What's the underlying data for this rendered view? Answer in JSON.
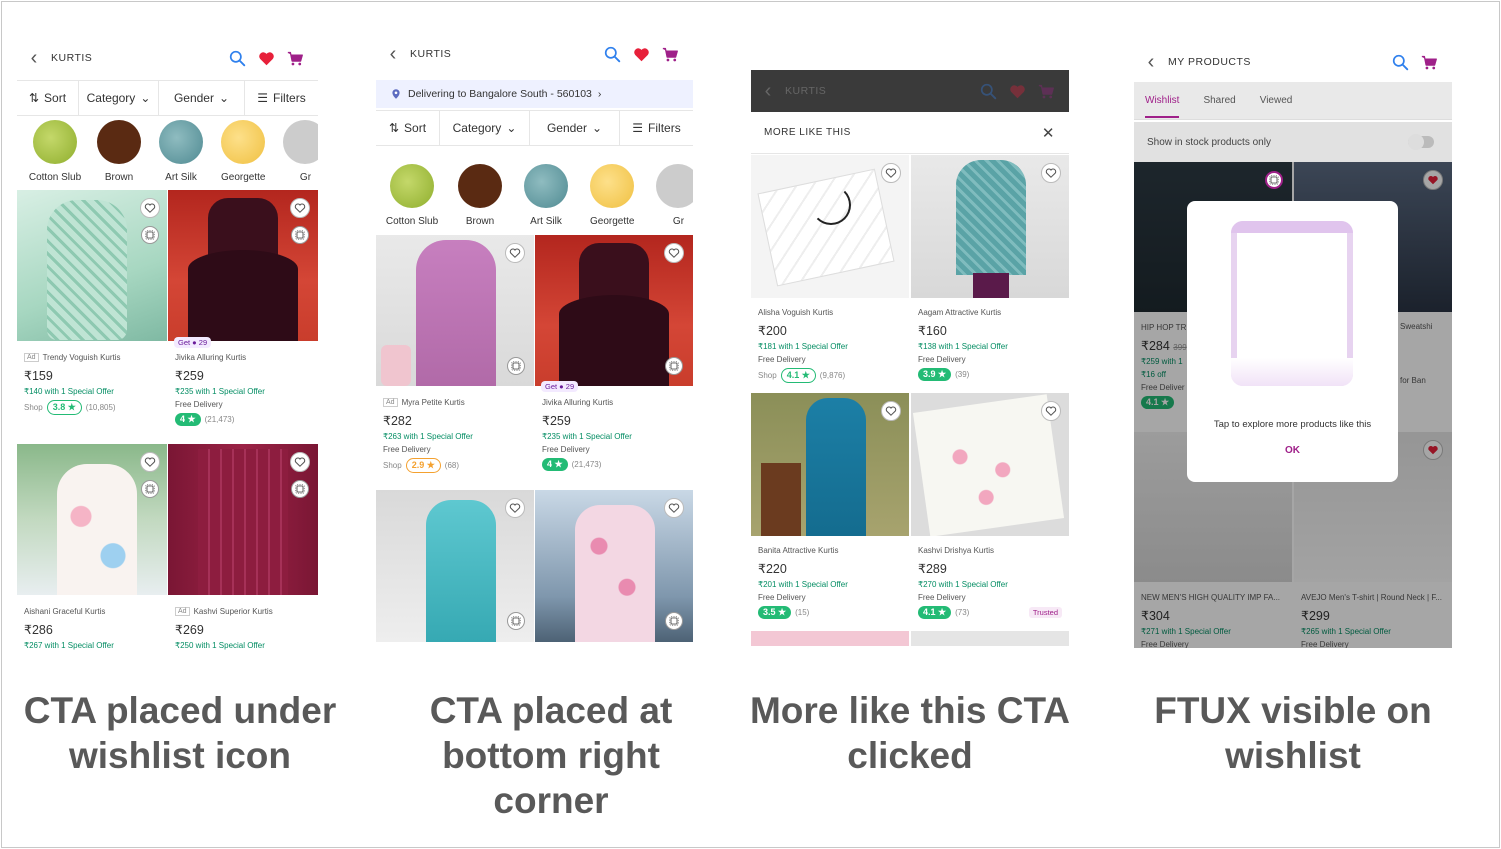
{
  "colors": {
    "accent": "#9f2089",
    "rating_green": "#23bb75",
    "offer_green": "#038d63",
    "search_blue": "#2f80ed",
    "heart_red": "#e7203a"
  },
  "header_icons": [
    "back-chevron-icon",
    "search-icon",
    "heart-icon",
    "cart-icon"
  ],
  "filter_bar": {
    "sort": "Sort",
    "category": "Category",
    "gender": "Gender",
    "filters": "Filters"
  },
  "chips": [
    "Cotton Slub",
    "Brown",
    "Art Silk",
    "Georgette",
    "Gr"
  ],
  "captions": {
    "p1": [
      "CTA placed under",
      "wishlist icon"
    ],
    "p2": [
      "CTA placed at",
      "bottom right",
      "corner"
    ],
    "p3": [
      "More like this CTA",
      "clicked"
    ],
    "p4": [
      "FTUX visible on",
      "wishlist"
    ]
  },
  "panel1": {
    "title": "KURTIS",
    "products": [
      {
        "ad": "Ad",
        "name": "Trendy Voguish Kurtis",
        "price": "₹159",
        "offer": "₹140 with 1 Special Offer",
        "shop": "Shop",
        "rating": "3.8 ★",
        "reviews": "(10,805)"
      },
      {
        "get": "Get ● 29",
        "name": "Jivika Alluring Kurtis",
        "price": "₹259",
        "offer": "₹235 with 1 Special Offer",
        "delivery": "Free Delivery",
        "rating": "4 ★",
        "reviews": "(21,473)"
      },
      {
        "name": "Aishani Graceful Kurtis",
        "price": "₹286",
        "offer": "₹267 with 1 Special Offer"
      },
      {
        "ad": "Ad",
        "name": "Kashvi Superior Kurtis",
        "price": "₹269",
        "offer": "₹250 with 1 Special Offer"
      }
    ]
  },
  "panel2": {
    "title": "KURTIS",
    "location": "Delivering to Bangalore South - 560103",
    "products": [
      {
        "ad": "Ad",
        "name": "Myra Petite Kurtis",
        "price": "₹282",
        "offer": "₹263 with 1 Special Offer",
        "delivery": "Free Delivery",
        "shop": "Shop",
        "rating": "2.9 ★",
        "reviews": "(68)"
      },
      {
        "get": "Get ● 29",
        "name": "Jivika Alluring Kurtis",
        "price": "₹259",
        "offer": "₹235 with 1 Special Offer",
        "delivery": "Free Delivery",
        "rating": "4 ★",
        "reviews": "(21,473)"
      }
    ]
  },
  "panel3": {
    "title": "KURTIS",
    "sheet_title": "MORE LIKE THIS",
    "products": [
      {
        "name": "Alisha Voguish Kurtis",
        "price": "₹200",
        "offer": "₹181 with 1 Special Offer",
        "delivery": "Free Delivery",
        "shop": "Shop",
        "rating": "4.1 ★",
        "reviews": "(9,876)"
      },
      {
        "name": "Aagam Attractive Kurtis",
        "price": "₹160",
        "offer": "₹138 with 1 Special Offer",
        "delivery": "Free Delivery",
        "rating": "3.9 ★",
        "reviews": "(39)"
      },
      {
        "name": "Banita Attractive Kurtis",
        "price": "₹220",
        "offer": "₹201 with 1 Special Offer",
        "delivery": "Free Delivery",
        "rating": "3.5 ★",
        "reviews": "(15)"
      },
      {
        "name": "Kashvi Drishya Kurtis",
        "price": "₹289",
        "offer": "₹270 with 1 Special Offer",
        "delivery": "Free Delivery",
        "rating": "4.1 ★",
        "reviews": "(73)",
        "trusted": "Trusted"
      }
    ]
  },
  "panel4": {
    "title": "MY PRODUCTS",
    "tabs": [
      "Wishlist",
      "Shared",
      "Viewed"
    ],
    "toggle_label": "Show in stock products only",
    "ftux_text": "Tap to explore more products like this",
    "ftux_ok": "OK",
    "peek": {
      "left_name": "HIP HOP TR",
      "left_price": "₹284",
      "left_strike": "399",
      "left_offer": "₹259 with 1",
      "left_discount": "₹16 off",
      "left_delivery": "Free Deliver",
      "left_rating": "4.1 ★",
      "right_name": "Sweatshi",
      "right_name2": "for Ban"
    },
    "products": [
      {
        "name": "NEW MEN'S HIGH QUALITY IMP FA...",
        "price": "₹304",
        "offer": "₹271 with 1 Special Offer",
        "delivery": "Free Delivery"
      },
      {
        "name": "AVEJO Men's T-shirt | Round Neck | F...",
        "price": "₹299",
        "offer": "₹265 with 1 Special Offer",
        "delivery": "Free Delivery"
      }
    ]
  }
}
